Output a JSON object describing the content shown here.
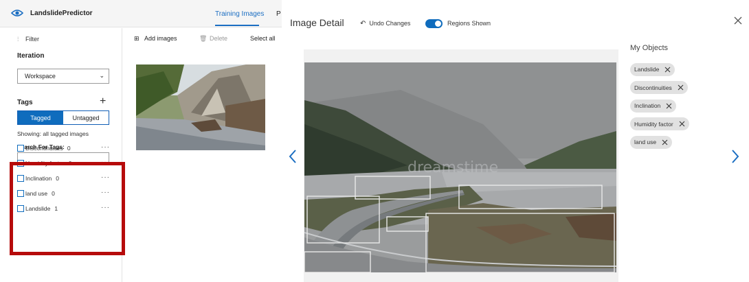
{
  "app": {
    "name": "LandslidePredictor",
    "tabs": [
      {
        "label": "Training Images",
        "active": true
      },
      {
        "label": "P"
      }
    ],
    "accent_color": "#0f6cbd"
  },
  "sidebar": {
    "filter_label": "Filter",
    "iteration_label": "Iteration",
    "iteration_value": "Workspace",
    "tags_label": "Tags",
    "tagged_label": "Tagged",
    "untagged_label": "Untagged",
    "showing_text": "Showing: all tagged images",
    "search_label": "Search For Tags:",
    "search_value": "",
    "tags": [
      {
        "name": "Discontinuities",
        "count": "0"
      },
      {
        "name": "Humidity factor",
        "count": "0"
      },
      {
        "name": "Inclination",
        "count": "0"
      },
      {
        "name": "land use",
        "count": "0"
      },
      {
        "name": "Landslide",
        "count": "1"
      }
    ],
    "highlight_color": "#b60b0b"
  },
  "toolbar": {
    "add_images": "Add images",
    "delete": "Delete",
    "select_all": "Select all"
  },
  "detail": {
    "title": "Image Detail",
    "undo_label": "Undo Changes",
    "regions_label": "Regions Shown",
    "regions_on": true,
    "objects_title": "My Objects",
    "objects": [
      "Landslide",
      "Discontinuities",
      "Inclination",
      "Humidity factor",
      "land use"
    ],
    "watermark": "dreamstime"
  }
}
